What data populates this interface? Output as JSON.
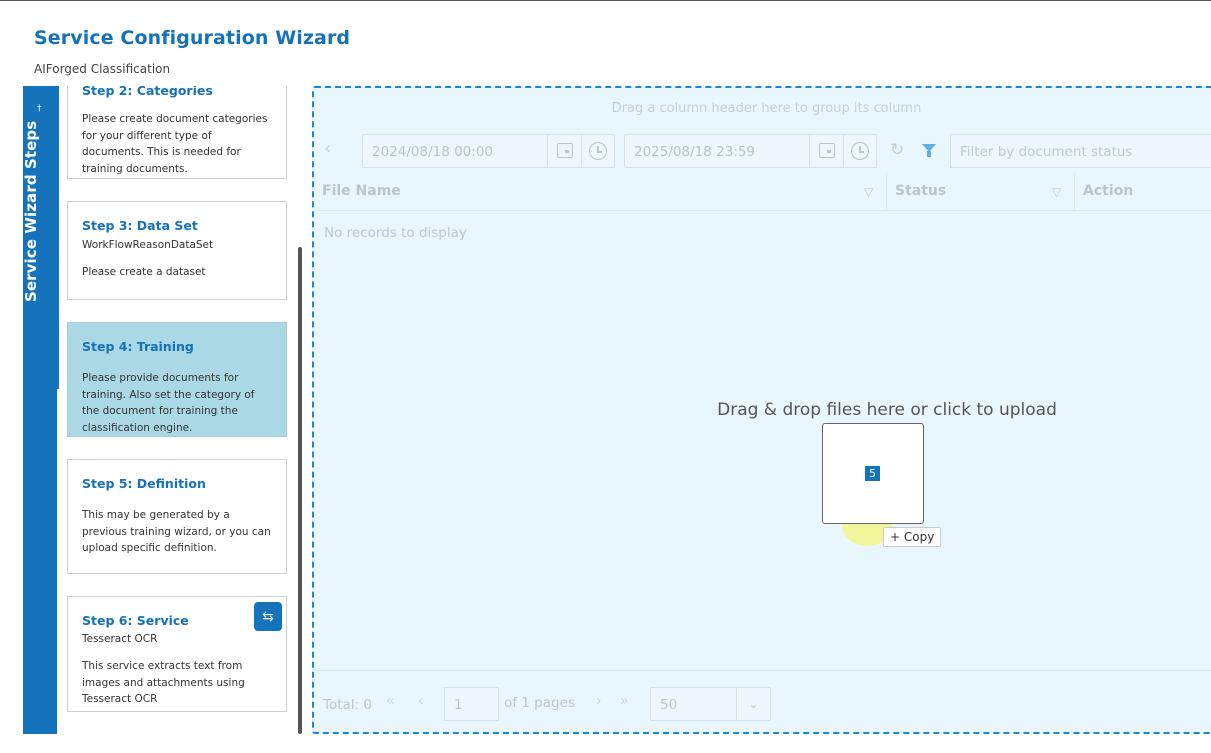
{
  "header": {
    "title": "Service Configuration Wizard",
    "subtitle": "AIForged Classification"
  },
  "sidebar": {
    "rail_label": "Service Wizard Steps",
    "pin_glyph": "†",
    "steps": [
      {
        "title": "Step 2: Categories",
        "subtitle": "",
        "description": "Please create document categories for your different type of documents. This is needed for training documents.",
        "active": false
      },
      {
        "title": "Step 3: Data Set",
        "subtitle": "WorkFlowReasonDataSet",
        "description": "Please create a dataset",
        "active": false
      },
      {
        "title": "Step 4: Training",
        "subtitle": "",
        "description": "Please provide documents for training. Also set the category of the document for training the classification engine.",
        "active": true
      },
      {
        "title": "Step 5: Definition",
        "subtitle": "",
        "description": "This may be generated by a previous training wizard, or you can upload specific definition.",
        "active": false
      },
      {
        "title": "Step 6: Service",
        "subtitle": "Tesseract OCR",
        "description": "This service extracts text from images and attachments using Tesseract OCR",
        "active": false
      }
    ],
    "swap_icon": "swap-arrows-icon"
  },
  "grid": {
    "group_hint": "Drag a column header here to group its column",
    "date_from": "2024/08/18 00:00",
    "date_to": "2025/08/18 23:59",
    "status_filter_placeholder": "Filter by document status",
    "columns": [
      "File Name",
      "Status",
      "Action"
    ],
    "empty_text": "No records to display",
    "pager": {
      "total": "Total: 0",
      "page": "1",
      "of_pages": "of 1 pages",
      "page_size": "50"
    }
  },
  "upload": {
    "message": "Drag & drop files here or click to upload",
    "drag_count": "5",
    "copy_label": "Copy"
  },
  "colors": {
    "accent": "#1573bc",
    "active_step": "#aad8e4",
    "dropzone_bg": "#eaf6fd"
  }
}
